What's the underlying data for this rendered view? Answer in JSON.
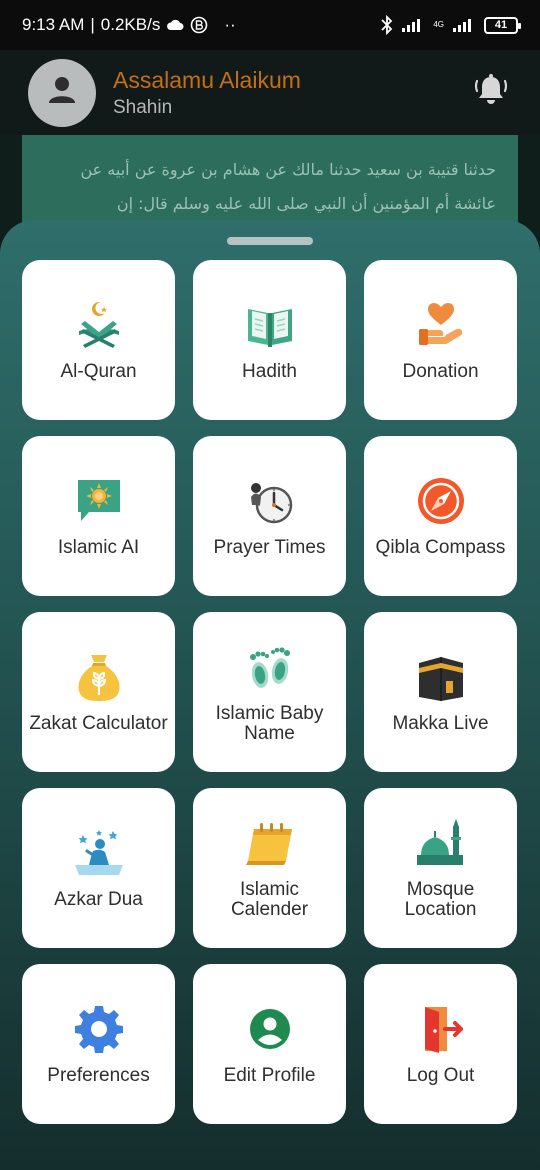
{
  "status_bar": {
    "time": "9:13 AM",
    "separator": "|",
    "speed": "0.2KB/s",
    "extra": "··",
    "network_type": "4G",
    "battery": "41",
    "icons": [
      "cloud-icon",
      "b-circle-icon",
      "bluetooth-icon",
      "signal-icon",
      "battery-icon"
    ]
  },
  "header": {
    "greeting": "Assalamu Alaikum",
    "user_name": "Shahin",
    "avatar_icon": "person-icon",
    "bell_icon": "bell-ringing-icon",
    "greeting_color": "#c46f17"
  },
  "hadith": {
    "text": "حدثنا قتيبة بن سعيد حدثنا مالك عن هشام بن عروة عن أبيه عن عائشة أم المؤمنين أن النبي صلى الله عليه وسلم قال: إن"
  },
  "menu": {
    "items": [
      {
        "label": "Al-Quran",
        "icon": "quran-stand-icon"
      },
      {
        "label": "Hadith",
        "icon": "open-book-icon"
      },
      {
        "label": "Donation",
        "icon": "donation-hand-icon"
      },
      {
        "label": "Islamic AI",
        "icon": "chat-sun-icon"
      },
      {
        "label": "Prayer Times",
        "icon": "clock-icon"
      },
      {
        "label": "Qibla Compass",
        "icon": "compass-icon"
      },
      {
        "label": "Zakat Calculator",
        "icon": "money-bag-icon"
      },
      {
        "label": "Islamic Baby Name",
        "icon": "baby-feet-icon"
      },
      {
        "label": "Makka Live",
        "icon": "kaaba-icon"
      },
      {
        "label": "Azkar Dua",
        "icon": "praying-person-icon"
      },
      {
        "label": "Islamic Calender",
        "icon": "calendar-icon"
      },
      {
        "label": "Mosque Location",
        "icon": "mosque-icon"
      },
      {
        "label": "Preferences",
        "icon": "gear-icon"
      },
      {
        "label": "Edit Profile",
        "icon": "profile-icon"
      },
      {
        "label": "Log Out",
        "icon": "logout-icon"
      }
    ]
  }
}
